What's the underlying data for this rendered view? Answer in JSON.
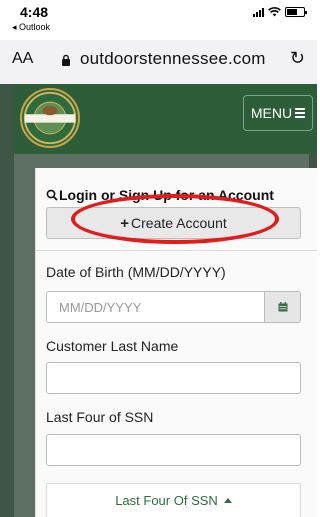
{
  "status_bar": {
    "time": "4:48",
    "back_label": "◂ Outlook"
  },
  "browser": {
    "text_size_label": "AA",
    "url": "outdoorstennessee.com",
    "reload_icon": "reload-icon"
  },
  "site": {
    "logo_icon": "twra-seal-logo",
    "menu_label": "MENU"
  },
  "form": {
    "login_title": "Login or Sign Up for an Account",
    "create_account_label": "Create Account",
    "dob_label": "Date of Birth (MM/DD/YYYY)",
    "dob_placeholder": "MM/DD/YYYY",
    "last_name_label": "Customer Last Name",
    "last_name_value": "",
    "ssn_label": "Last Four of SSN",
    "ssn_value": "",
    "ssn_toggle_label": "Last Four Of SSN"
  },
  "colors": {
    "header_green": "#2e5d3a",
    "highlight_red": "#e21b1b",
    "link_green": "#2e6b3d"
  }
}
